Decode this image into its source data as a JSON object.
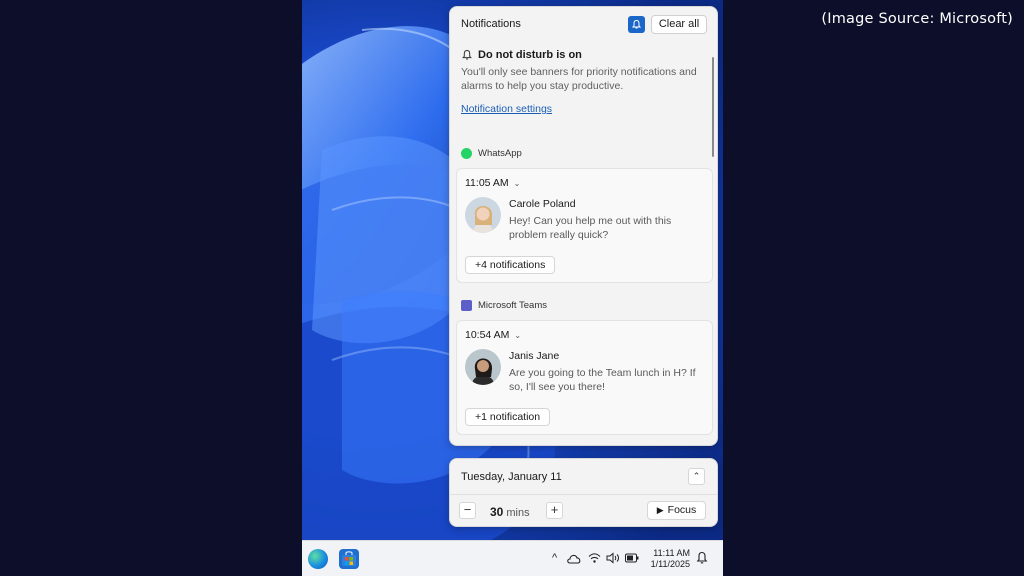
{
  "credit": "(Image Source: Microsoft)",
  "notifications": {
    "title": "Notifications",
    "clear_all": "Clear all",
    "dnd": {
      "title": "Do not disturb is on",
      "description": "You'll only see banners for priority notifications and alarms to help you stay productive.",
      "settings_link": "Notification settings"
    },
    "groups": [
      {
        "app": "WhatsApp",
        "app_color": "#25d366",
        "time": "11:05 AM",
        "sender": "Carole Poland",
        "message": "Hey! Can you help me out with this problem really quick?",
        "more": "+4 notifications"
      },
      {
        "app": "Microsoft Teams",
        "app_color": "#5b5fc7",
        "time": "10:54 AM",
        "sender": "Janis Jane",
        "message": "Are you going to the Team lunch in H? If so, I'll see you there!",
        "more": "+1 notification"
      }
    ]
  },
  "calendar": {
    "date": "Tuesday, January 11",
    "minus": "−",
    "plus": "+",
    "focus_value": "30",
    "focus_unit": "mins",
    "focus_label": "Focus"
  },
  "taskbar": {
    "time": "11:11 AM",
    "date": "1/11/2025",
    "tray_chevron": "^"
  },
  "colors": {
    "accent": "#1b66c9",
    "link": "#1b5fb5"
  }
}
